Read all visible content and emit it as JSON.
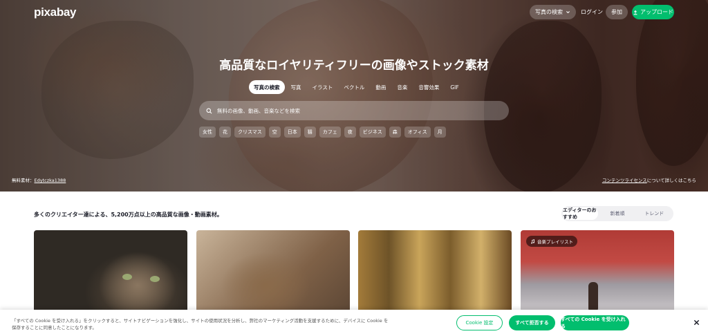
{
  "header": {
    "logo": "pixabay",
    "search_menu_label": "写真の検索",
    "login_label": "ログイン",
    "join_label": "参加",
    "upload_label": "アップロード"
  },
  "hero": {
    "title": "高品質なロイヤリティフリーの画像やストック素材",
    "tabs": [
      {
        "label": "写真の検索",
        "active": true
      },
      {
        "label": "写真"
      },
      {
        "label": "イラスト"
      },
      {
        "label": "ベクトル"
      },
      {
        "label": "動画"
      },
      {
        "label": "音楽"
      },
      {
        "label": "音響効果"
      },
      {
        "label": "GIF"
      }
    ],
    "search_placeholder": "無料の画像、動画、音楽などを検索",
    "tags": [
      "女性",
      "花",
      "クリスマス",
      "空",
      "日本",
      "猫",
      "カフェ",
      "夜",
      "ビジネス",
      "森",
      "オフィス",
      "月"
    ],
    "credit_prefix": "無料素材：",
    "credit_user": "Edytczka1388",
    "license_link": "コンテンツライセンス",
    "license_suffix": "について詳しくはこちら"
  },
  "main": {
    "heading": "多くのクリエイター達による、5,200万点以上の高品質な画像・動画素材。",
    "sort_options": [
      {
        "label": "エディターのおすすめ",
        "active": true
      },
      {
        "label": "新着順"
      },
      {
        "label": "トレンド"
      }
    ],
    "playlist_badge": "音楽プレイリスト"
  },
  "cookie_banner": {
    "text": "「すべての Cookie を受け入れる」をクリックすると、サイトナビゲーションを強化し、サイトの使用状況を分析し、弊社のマーケティング活動を支援するために、デバイスに Cookie を保存することに同意したことになります。",
    "settings_label": "Cookie 設定",
    "reject_label": "すべて拒否する",
    "accept_label": "すべての Cookie を受け入れる"
  },
  "colors": {
    "brand_green": "#02be6e",
    "text_dark": "#191b26"
  },
  "icons": {
    "search": "search-icon",
    "chevron": "chevron-down-icon",
    "upload": "upload-icon",
    "music": "music-note-icon",
    "close": "close-icon"
  }
}
